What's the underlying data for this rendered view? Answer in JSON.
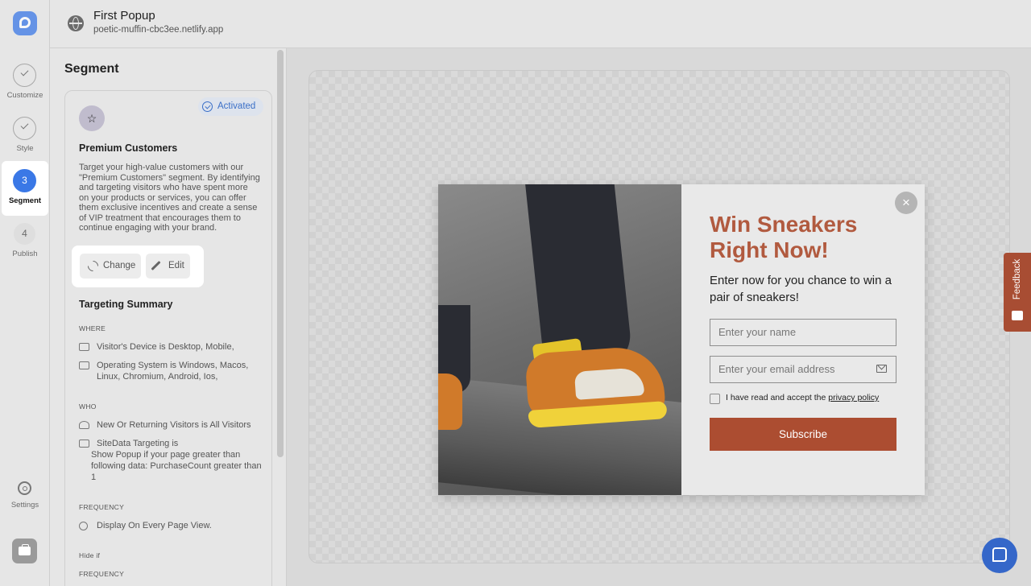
{
  "header": {
    "title": "First Popup",
    "subtitle": "poetic-muffin-cbc3ee.netlify.app"
  },
  "steps": [
    {
      "label": "Customize",
      "state": "done"
    },
    {
      "label": "Style",
      "state": "done"
    },
    {
      "label": "Segment",
      "number": "3",
      "state": "active"
    },
    {
      "label": "Publish",
      "number": "4",
      "state": "pending"
    }
  ],
  "rail": {
    "settings_label": "Settings"
  },
  "panel": {
    "title": "Segment",
    "segment": {
      "badge": "Activated",
      "name": "Premium Customers",
      "description": "Target your high-value customers with our \"Premium Customers\" segment. By identifying and targeting visitors who have spent more on your products or services, you can offer them exclusive incentives and create a sense of VIP treatment that encourages them to continue engaging with your brand.",
      "change_label": "Change",
      "edit_label": "Edit"
    },
    "targeting": {
      "title": "Targeting Summary",
      "where_label": "WHERE",
      "device": "Visitor's Device is Desktop, Mobile,",
      "os": "Operating System is Windows, Macos, Linux, Chromium, Android, Ios,",
      "who_label": "WHO",
      "visitors": "New Or Returning Visitors is All Visitors",
      "sitedata_title": "SiteData Targeting is",
      "sitedata_detail": "Show Popup if your page greater than following data: PurchaseCount greater than 1",
      "frequency_label": "FREQUENCY",
      "frequency": "Display On Every Page View.",
      "hide_if_label": "Hide if",
      "frequency_label_2": "FREQUENCY"
    }
  },
  "popup": {
    "heading": "Win Sneakers Right Now!",
    "text": "Enter now for you chance to win a pair of sneakers!",
    "name_placeholder": "Enter your name",
    "email_placeholder": "Enter your email address",
    "consent_prefix": "I have read and accept the ",
    "consent_link": "privacy policy",
    "submit_label": "Subscribe",
    "close_glyph": "×"
  },
  "feedback_label": "Feedback",
  "colors": {
    "accent": "#3a78e6",
    "popup_heading": "#b15a3f",
    "submit": "#ac4d31",
    "feedback_tab": "#a84d33",
    "chat": "#3567c9"
  }
}
